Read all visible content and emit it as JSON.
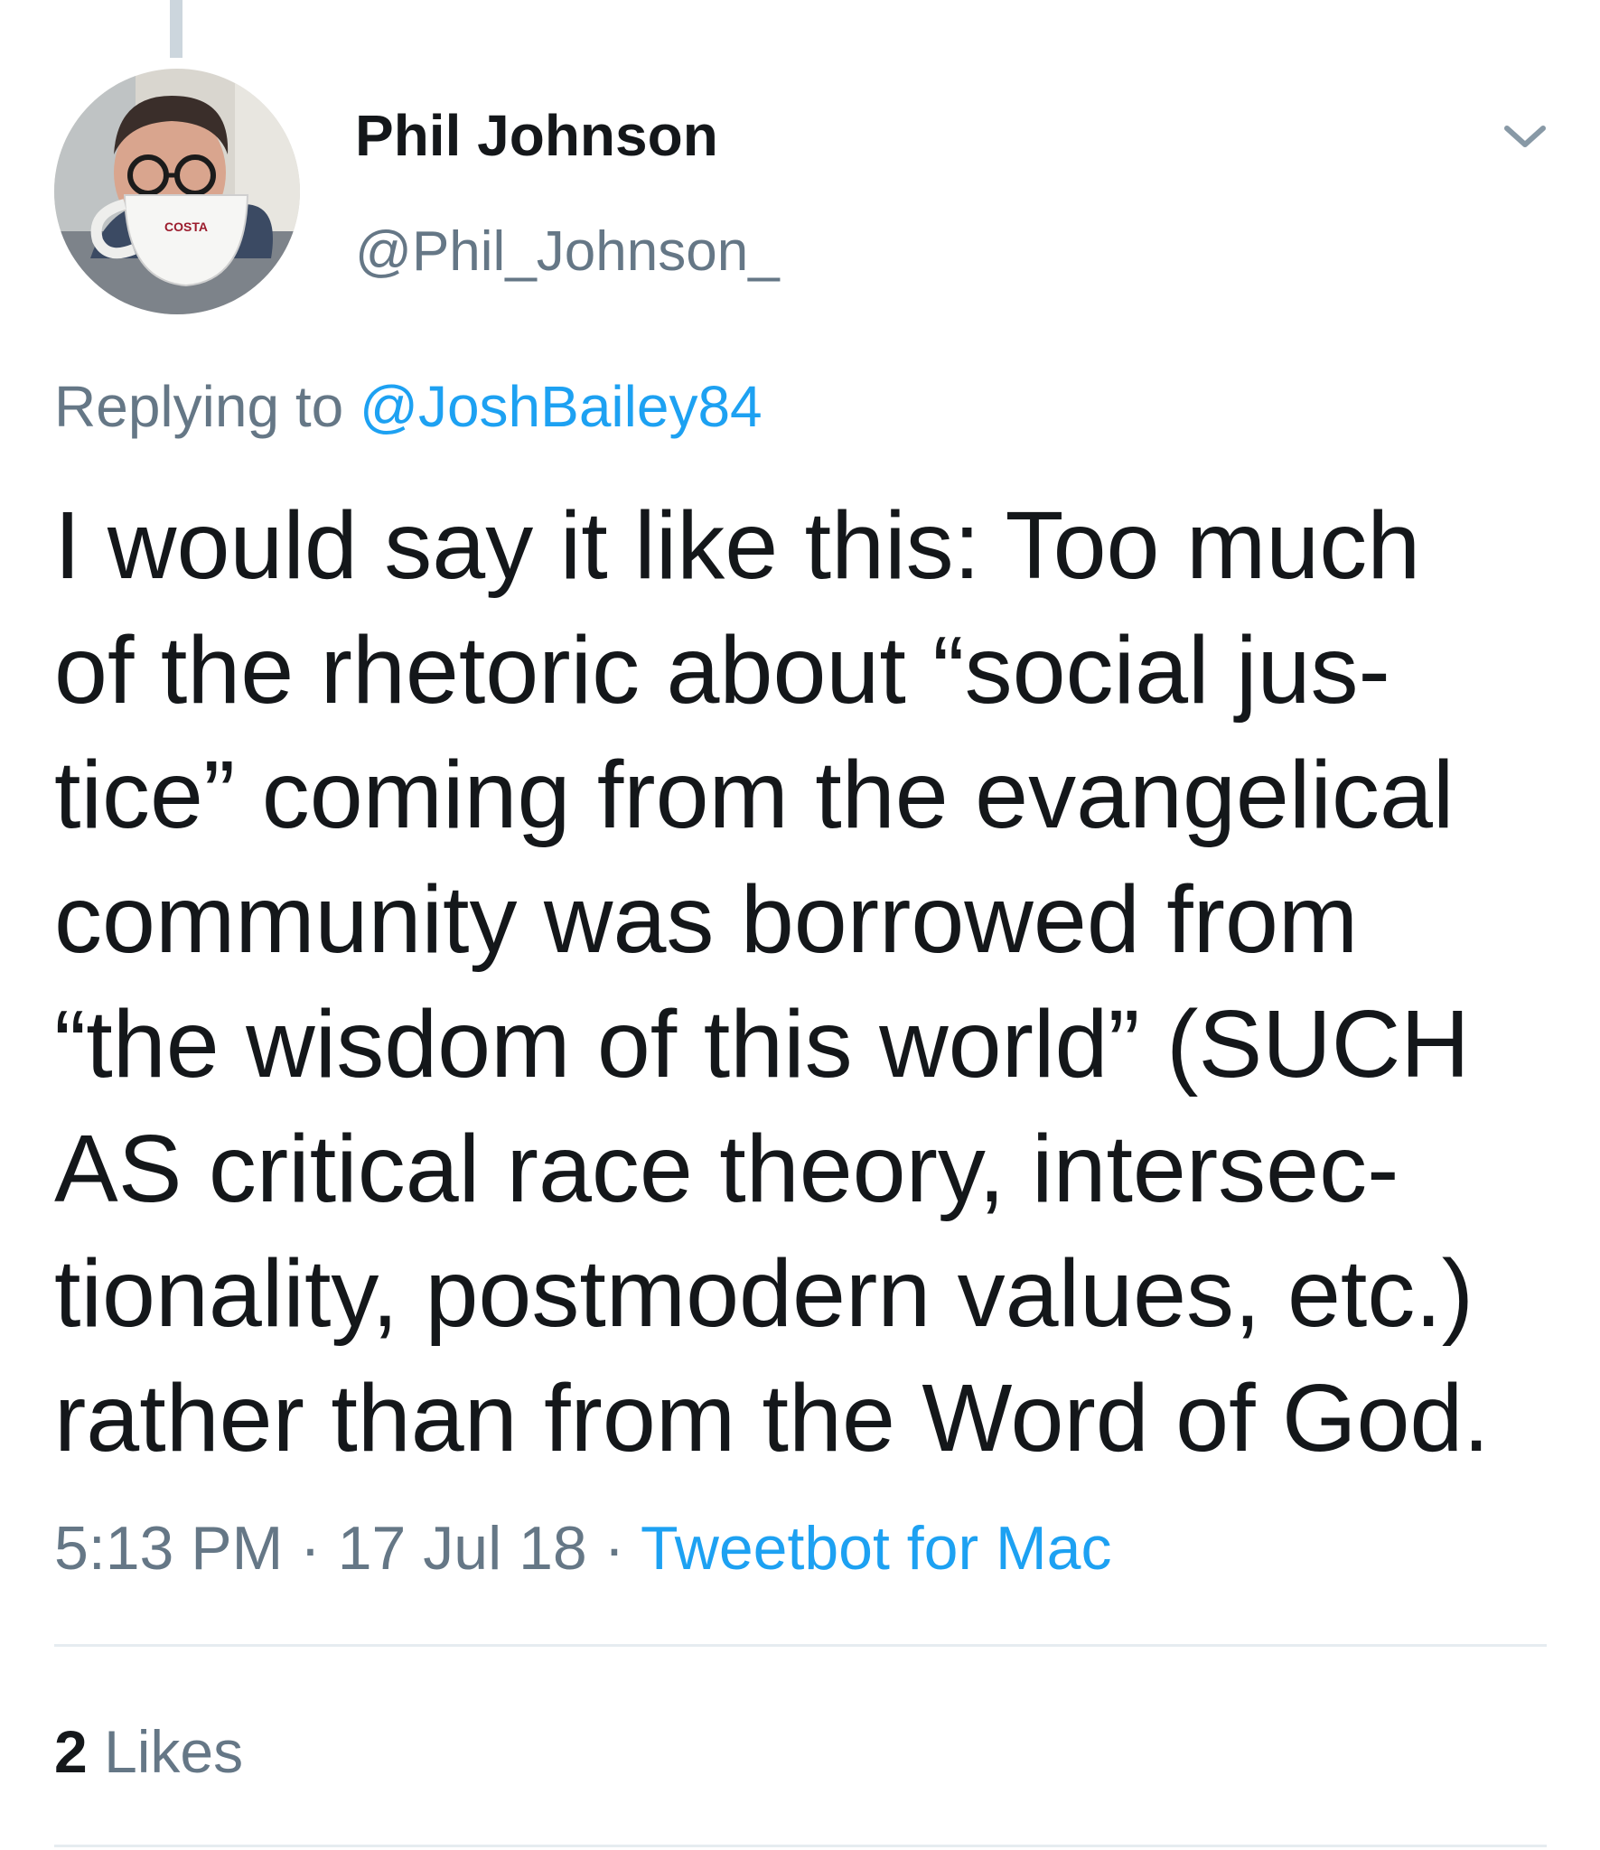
{
  "tweet": {
    "display_name": "Phil Johnson",
    "handle": "@Phil_Johnson_",
    "replying_prefix": "Replying to",
    "replying_handle": "@JoshBailey84",
    "text_lines": [
      "I would say it like this: Too much",
      "of the rhetoric about “social jus-",
      "tice” coming from the evangelical",
      "community was borrowed from",
      "“the wisdom of this world” (SUCH",
      "AS critical race theory, intersec-",
      "tionality, postmodern values, etc.)",
      "rather than from the Word of God."
    ],
    "time": "5:13 PM",
    "date": "17 Jul 18",
    "separator": "·",
    "source": "Tweetbot for Mac",
    "likes_count": "2",
    "likes_label": "Likes",
    "avatar_mug_text": "COSTA"
  },
  "colors": {
    "text_primary": "#14171a",
    "text_secondary": "#657786",
    "link": "#1da1f2",
    "divider": "#e6ecf0",
    "thread_line": "#ccd6dd"
  },
  "icons": {
    "caret": "chevron-down-icon"
  }
}
